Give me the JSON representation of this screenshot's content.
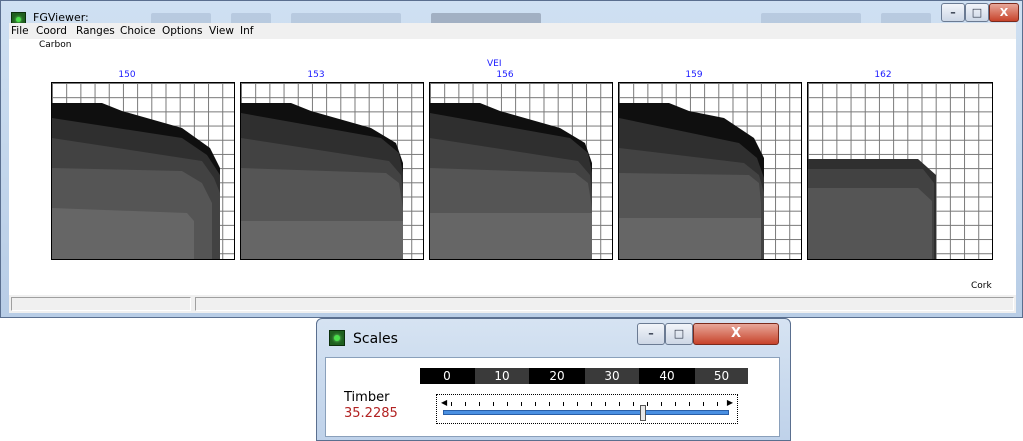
{
  "main_window": {
    "title": "FGViewer:",
    "menu": [
      "File",
      "Coord",
      "Ranges",
      "Choice",
      "Options",
      "View",
      "Inf"
    ]
  },
  "plot": {
    "top_left_label": "Carbon",
    "top_center_label": "VEI",
    "bottom_right_label": "Cork",
    "panels": [
      {
        "label": "150"
      },
      {
        "label": "153"
      },
      {
        "label": "156"
      },
      {
        "label": "159"
      },
      {
        "label": "162"
      }
    ]
  },
  "scales_window": {
    "title": "Scales",
    "ruler_ticks": [
      "0",
      "10",
      "20",
      "30",
      "40",
      "50"
    ],
    "variable_label": "Timber",
    "variable_value": "35.2285",
    "slider_fraction": 0.7
  },
  "colors": {
    "panel_number": "#1a1aff",
    "value_text": "#b22222",
    "slider_track": "#4a90e2"
  }
}
